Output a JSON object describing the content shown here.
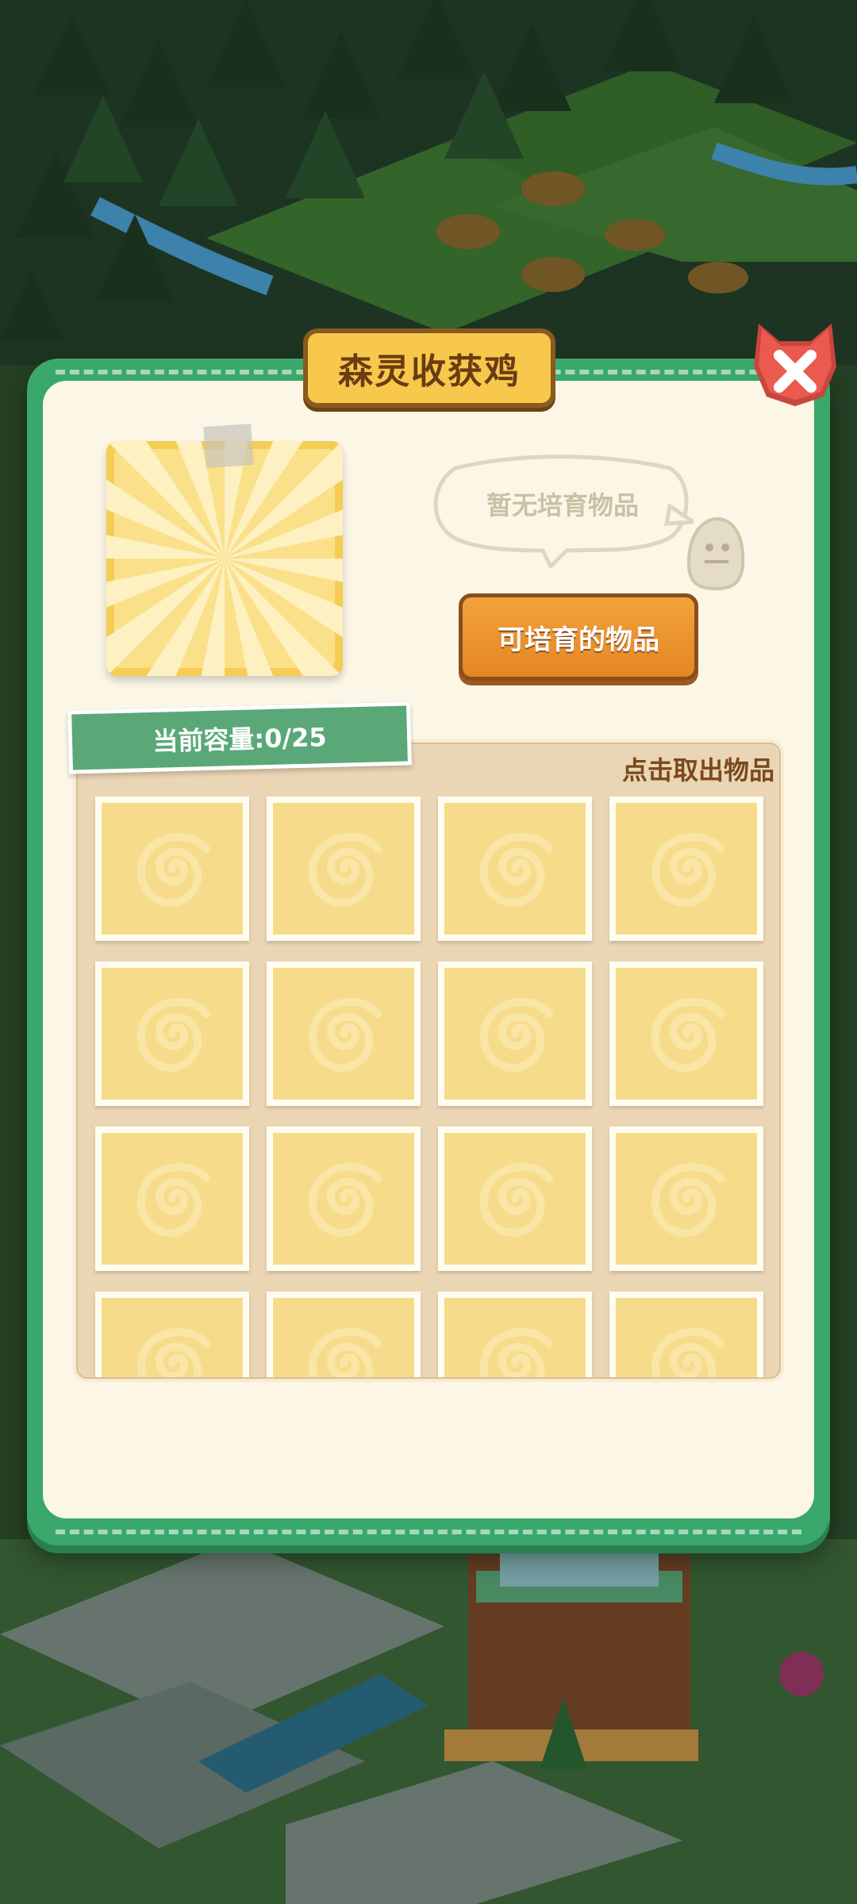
{
  "dialog": {
    "title": "森灵收获鸡",
    "close_icon": "close-x-icon",
    "speech_text": "暂无培育物品",
    "breed_button_label": "可培育的物品",
    "capacity_label": "当前容量:0/25",
    "take_out_hint": "点击取出物品"
  },
  "storage": {
    "capacity_used": 0,
    "capacity_total": 25,
    "visible_slots": 16,
    "slot_icon": "empty-slot-swirl-icon"
  },
  "colors": {
    "frame_green": "#3ba86b",
    "panel_cream": "#fbf6e6",
    "title_gold": "#f7c84b",
    "button_orange": "#e48623",
    "close_red": "#e8524a",
    "slot_yellow": "#f6db8a"
  }
}
